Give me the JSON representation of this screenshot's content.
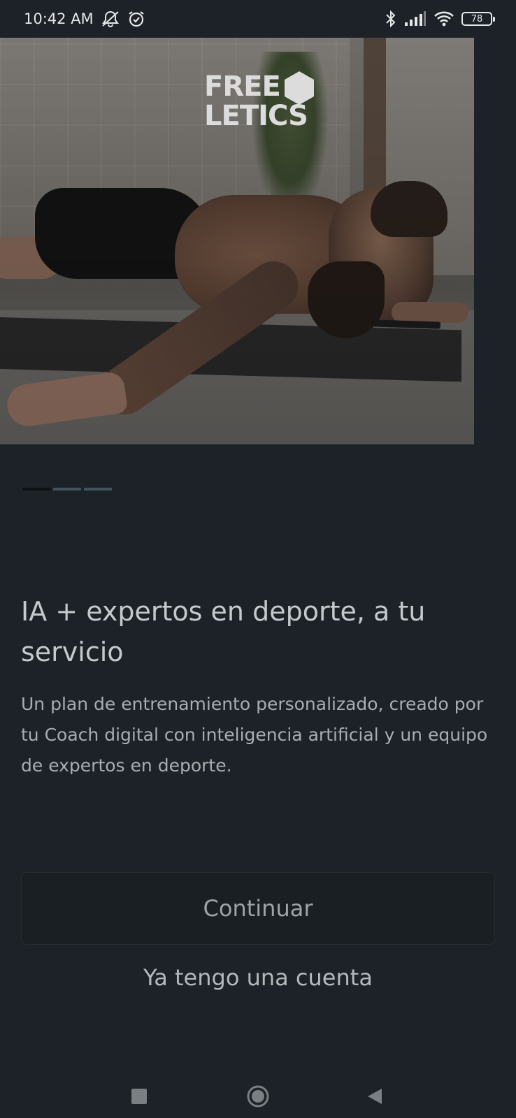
{
  "status_bar": {
    "time": "10:42 AM",
    "battery": "78",
    "icons": [
      "mute-notifications-icon",
      "alarm-icon",
      "bluetooth-icon",
      "signal-icon",
      "wifi-icon",
      "battery-icon"
    ]
  },
  "hero": {
    "logo_line1": "FREE",
    "logo_line2": "LETICS"
  },
  "pager": {
    "total": 3,
    "active_index": 0
  },
  "content": {
    "headline": "IA + expertos en deporte, a tu servicio",
    "description": "Un plan de entrenamiento personalizado, creado por tu Coach digital con inteligencia artificial y un equipo de expertos en deporte."
  },
  "actions": {
    "continue_label": "Continuar",
    "login_label": "Ya tengo una cuenta"
  },
  "nav_bar": {
    "icons": [
      "recents-square-icon",
      "home-circle-icon",
      "back-triangle-icon"
    ]
  },
  "colors": {
    "background": "#1c2227",
    "pager_active": "#0d1114",
    "pager_inactive": "#42535d"
  }
}
